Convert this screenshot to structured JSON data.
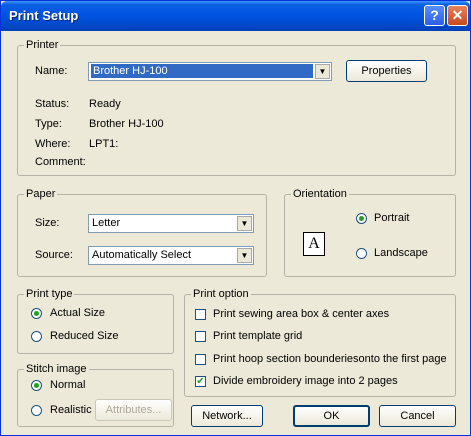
{
  "window": {
    "title": "Print Setup",
    "help_icon": "?",
    "close_icon": "✕"
  },
  "printer": {
    "legend": "Printer",
    "name_label": "Name:",
    "name_value": "Brother HJ-100",
    "properties_button": "Properties",
    "status_label": "Status:",
    "status_value": "Ready",
    "type_label": "Type:",
    "type_value": "Brother HJ-100",
    "where_label": "Where:",
    "where_value": "LPT1:",
    "comment_label": "Comment:"
  },
  "paper": {
    "legend": "Paper",
    "size_label": "Size:",
    "size_value": "Letter",
    "source_label": "Source:",
    "source_value": "Automatically Select"
  },
  "orientation": {
    "legend": "Orientation",
    "icon_letter": "A",
    "portrait": "Portrait",
    "portrait_selected": true,
    "landscape": "Landscape",
    "landscape_selected": false
  },
  "print_type": {
    "legend": "Print type",
    "actual": "Actual Size",
    "actual_selected": true,
    "reduced": "Reduced Size",
    "reduced_selected": false
  },
  "stitch_image": {
    "legend": "Stitch image",
    "normal": "Normal",
    "normal_selected": true,
    "realistic": "Realistic",
    "realistic_selected": false,
    "attributes_button": "Attributes..."
  },
  "print_option": {
    "legend": "Print option",
    "options": [
      {
        "label": "Print sewing area box & center axes",
        "checked": false
      },
      {
        "label": "Print template grid",
        "checked": false
      },
      {
        "label": "Print hoop section bounderiesonto the first page",
        "checked": false
      },
      {
        "label": "Divide embroidery image into 2 pages",
        "checked": true
      }
    ]
  },
  "buttons": {
    "network": "Network...",
    "ok": "OK",
    "cancel": "Cancel"
  },
  "colors": {
    "titlebar": "#0054e3",
    "dialog_bg": "#ece9d8",
    "selection": "#316ac5",
    "radio_dot": "#21a121"
  }
}
